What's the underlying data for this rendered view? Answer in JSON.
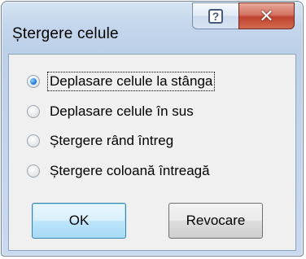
{
  "dialog": {
    "title": "Ștergere celule",
    "help_glyph": "?",
    "close_glyph": "✕"
  },
  "options": [
    {
      "label": "Deplasare celule la stânga",
      "selected": true
    },
    {
      "label": "Deplasare celule în sus",
      "selected": false
    },
    {
      "label": "Ștergere rând întreg",
      "selected": false
    },
    {
      "label": "Ștergere coloană întreagă",
      "selected": false
    }
  ],
  "buttons": {
    "ok_label": "OK",
    "cancel_label": "Revocare"
  },
  "colors": {
    "frame": "#c4d6ec",
    "close": "#c0432f",
    "default_button": "#bee6fd"
  },
  "icons": [
    "help-icon",
    "close-icon"
  ]
}
